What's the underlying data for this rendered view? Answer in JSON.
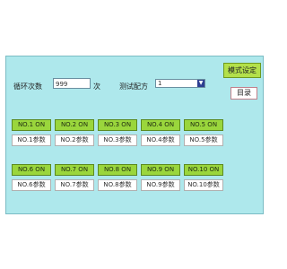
{
  "header": {
    "cycles_label": "循环次数",
    "cycles_value": "999",
    "cycles_unit": "次",
    "recipe_label": "测试配方",
    "recipe_value": "1",
    "mode_button": "模式设定",
    "directory_button": "目录"
  },
  "channels": [
    {
      "on": "NO.1 ON",
      "param": "NO.1参数"
    },
    {
      "on": "NO.2 ON",
      "param": "NO.2参数"
    },
    {
      "on": "NO.3 ON",
      "param": "NO.3参数"
    },
    {
      "on": "NO.4 ON",
      "param": "NO.4参数"
    },
    {
      "on": "NO.5 ON",
      "param": "NO.5参数"
    },
    {
      "on": "NO.6 ON",
      "param": "NO.6参数"
    },
    {
      "on": "NO.7 ON",
      "param": "NO.7参数"
    },
    {
      "on": "NO.8 ON",
      "param": "NO.8参数"
    },
    {
      "on": "NO.9 ON",
      "param": "NO.9参数"
    },
    {
      "on": "NO.10 ON",
      "param": "NO.10参数"
    }
  ],
  "colors": {
    "screen_bg": "#aee8ec",
    "on_button": "#9ad63c",
    "mode_button": "#b3e04a"
  }
}
